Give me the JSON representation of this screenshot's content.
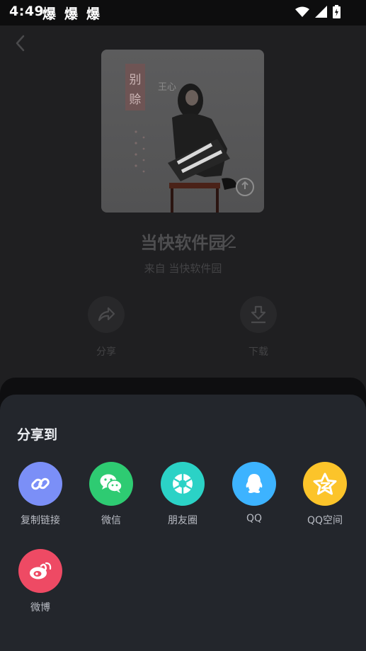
{
  "status_bar": {
    "time": "4:49",
    "notification_icons": [
      "爆",
      "爆",
      "爆"
    ],
    "icons": [
      "wifi-icon",
      "signal-icon",
      "battery-charging-icon"
    ]
  },
  "header": {
    "back_icon": "chevron-left-icon"
  },
  "cover": {
    "title_chars": [
      "别",
      "赊"
    ],
    "subtitle": "王心"
  },
  "profile": {
    "name": "当快软件园",
    "source": "来自  当快软件园"
  },
  "actions": [
    {
      "label": "分享",
      "icon": "share-arrow-icon"
    },
    {
      "label": "下载",
      "icon": "download-icon"
    }
  ],
  "share_sheet": {
    "title": "分享到",
    "items": [
      {
        "label": "复制链接",
        "icon": "link-icon",
        "color": "#7b8ff7"
      },
      {
        "label": "微信",
        "icon": "wechat-icon",
        "color": "#2ecb72"
      },
      {
        "label": "朋友圈",
        "icon": "moments-icon",
        "color": "#2bd2c6"
      },
      {
        "label": "QQ",
        "icon": "qq-icon",
        "color": "#3db3ff"
      },
      {
        "label": "QQ空间",
        "icon": "qzone-star-icon",
        "color": "#fcc42a"
      },
      {
        "label": "微博",
        "icon": "weibo-icon",
        "color": "#ee4a64"
      }
    ]
  }
}
